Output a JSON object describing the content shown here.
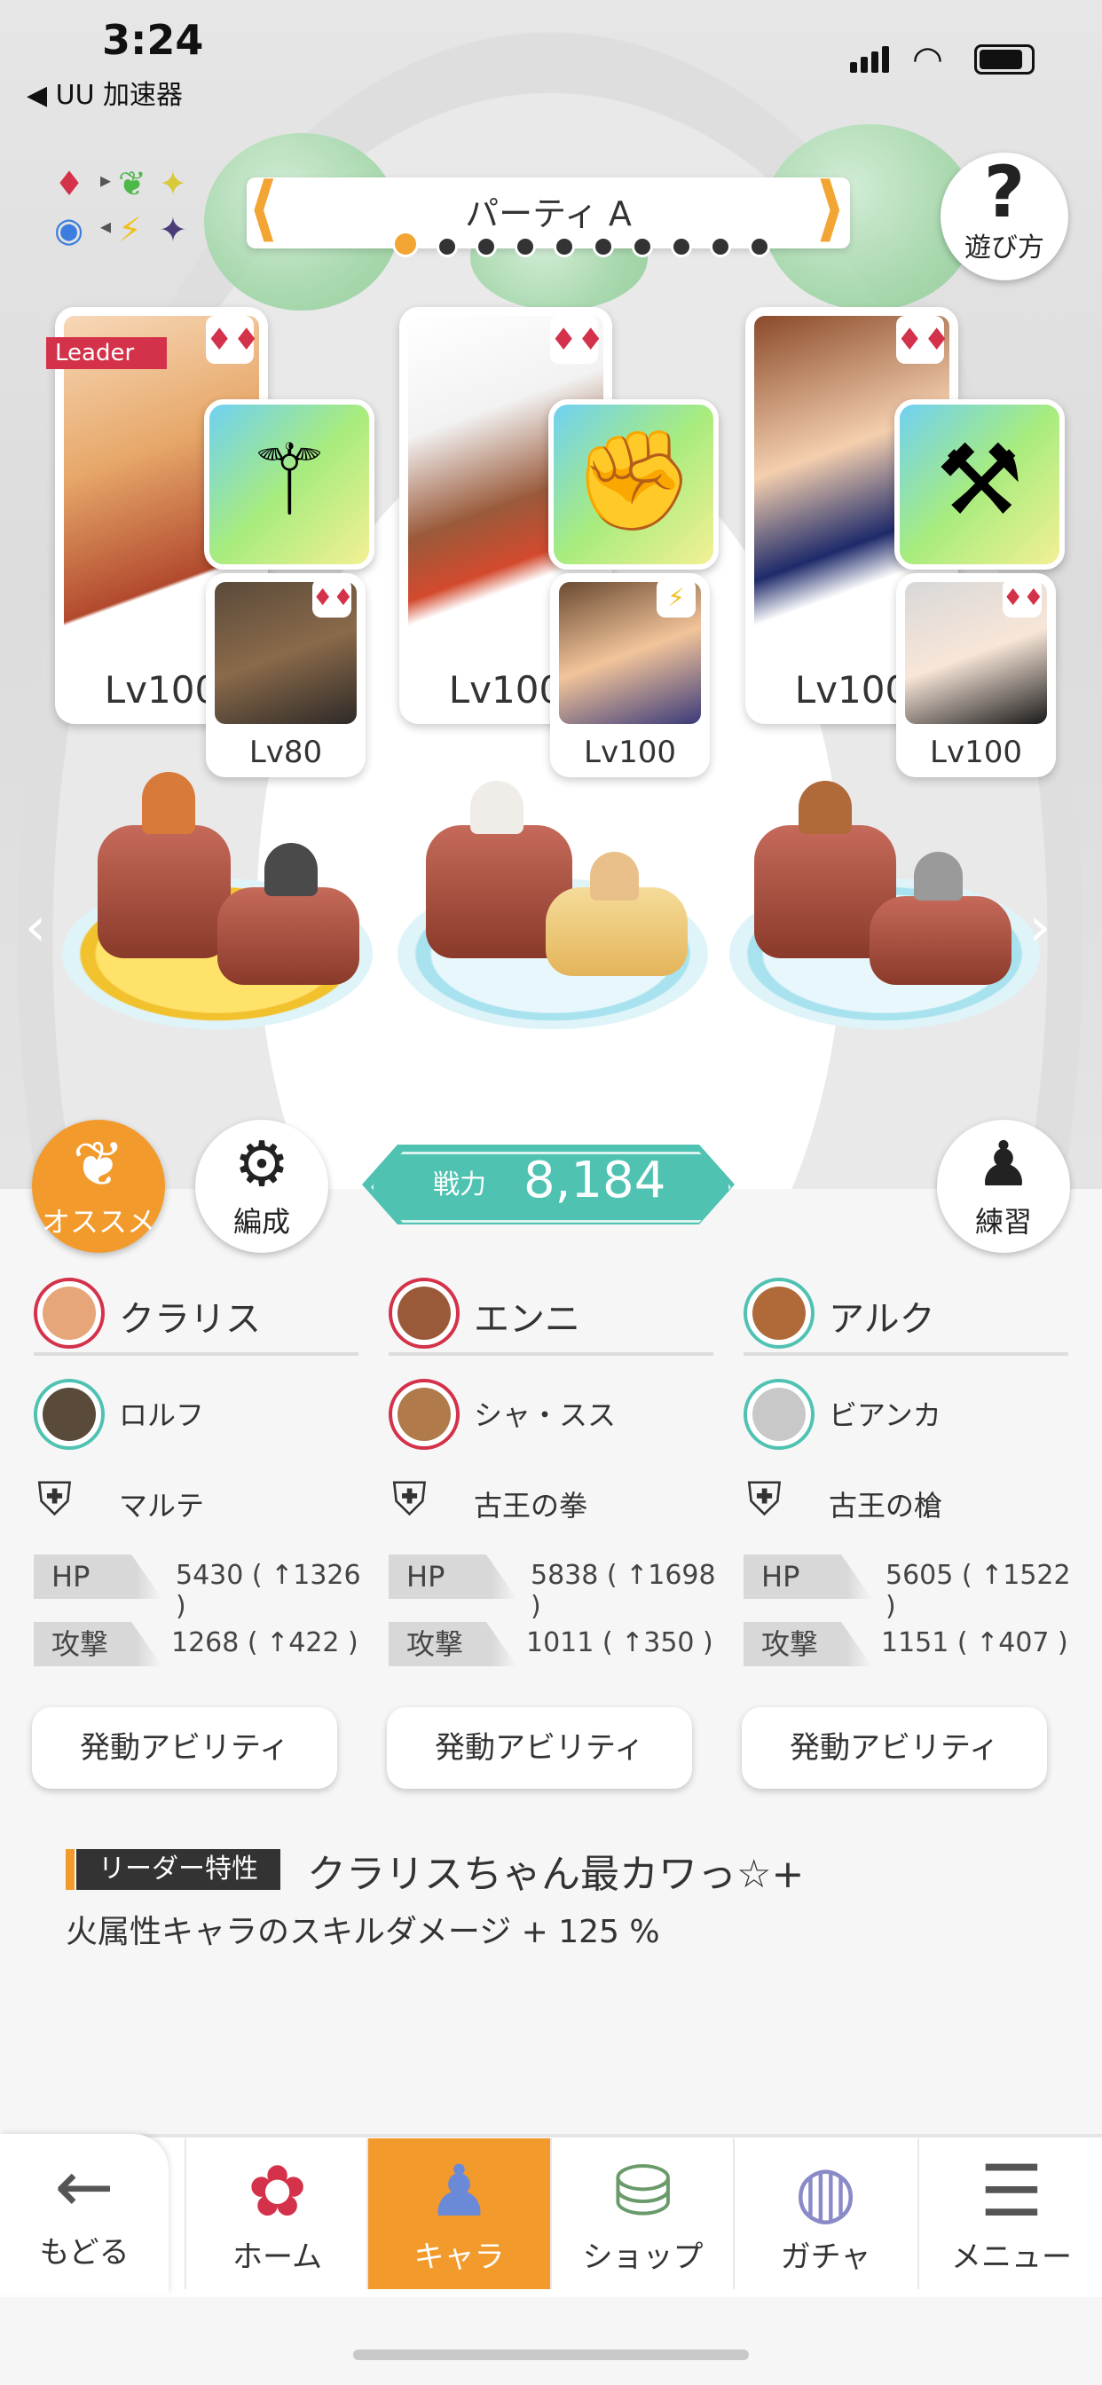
{
  "status_bar": {
    "time": "3:24",
    "back_app": "◀ UU 加速器"
  },
  "party": {
    "name": "パーティ A",
    "page_count": 10,
    "current_page": 1
  },
  "help": {
    "label": "遊び方",
    "icon": "question-icon"
  },
  "leader_tag": "Leader",
  "units": [
    {
      "main_level": "Lv100",
      "sub_level": "Lv80"
    },
    {
      "main_level": "Lv100",
      "sub_level": "Lv100"
    },
    {
      "main_level": "Lv100",
      "sub_level": "Lv100"
    }
  ],
  "buttons": {
    "osusume": "オススメ",
    "formation": "編成",
    "practice": "練習"
  },
  "power": {
    "label": "戦力",
    "value": "8,184"
  },
  "columns": [
    {
      "main_name": "クラリス",
      "sub_name": "ロルフ",
      "weapon": "マルテ",
      "hp_label": "HP",
      "hp": "5430 ( ↑1326 )",
      "atk_label": "攻撃",
      "atk": "1268 ( ↑422 )",
      "ability": "発動アビリティ"
    },
    {
      "main_name": "エンニ",
      "sub_name": "シャ・スス",
      "weapon": "古王の拳",
      "hp_label": "HP",
      "hp": "5838 ( ↑1698 )",
      "atk_label": "攻撃",
      "atk": "1011 ( ↑350 )",
      "ability": "発動アビリティ"
    },
    {
      "main_name": "アルク",
      "sub_name": "ビアンカ",
      "weapon": "古王の槍",
      "hp_label": "HP",
      "hp": "5605 ( ↑1522 )",
      "atk_label": "攻撃",
      "atk": "1151 ( ↑407 )",
      "ability": "発動アビリティ"
    }
  ],
  "leader_skill": {
    "label": "リーダー特性",
    "name": "クラリスちゃん最カワっ☆+",
    "description": "火属性キャラのスキルダメージ + 125 %"
  },
  "nav": {
    "back": "もどる",
    "items": [
      "ホーム",
      "キャラ",
      "ショップ",
      "ガチャ",
      "メニュー"
    ],
    "active": "キャラ"
  },
  "colors": {
    "accent": "#f39a2c",
    "teal": "#4fc2b2",
    "fire": "#d4324a"
  }
}
